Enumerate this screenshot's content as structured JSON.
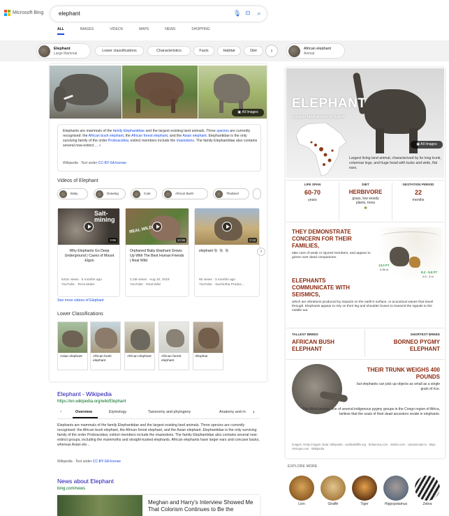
{
  "brand": "Microsoft Bing",
  "search": {
    "query": "elephant"
  },
  "tabs": [
    "ALL",
    "IMAGES",
    "VIDEOS",
    "MAPS",
    "NEWS",
    "SHOPPING"
  ],
  "entity": {
    "name": "Elephant",
    "type": "Large Mammal"
  },
  "filters": [
    "Lower classifications",
    "Characteristics",
    "Facts",
    "Habitat",
    "Diet"
  ],
  "right_chip": {
    "name": "African elephant",
    "type": "Animal"
  },
  "all_images": "All Images",
  "description": {
    "pre": "Elephants are mammals of the ",
    "l1": "family Elephantidae",
    "m1": " and the largest existing land animals. Three ",
    "l2": "species",
    "m2": " are currently recognised: the ",
    "l3": "African bush elephant",
    "m3": ", the ",
    "l4": "African forest elephant",
    "m4": ", and the ",
    "l5": "Asian elephant",
    "m5": ". Elephantidae is the only surviving family of the order ",
    "l6": "Proboscidea",
    "m6": "; extinct members include the ",
    "l7": "mastodons",
    "m7": ". The family Elephantidae also contains several now-extinct ... ",
    "more": "»",
    "source": "Wikipedia · Text under ",
    "license": "CC-BY-SA license"
  },
  "videos": {
    "heading": "Videos of Elephant",
    "chips": [
      "Baby",
      "Drawing",
      "Cute",
      "African Bush",
      "Thailand"
    ],
    "items": [
      {
        "title": "Why Elephants Go Deep Underground | Caves of Mount Elgon",
        "overlay": "Salt-\nmining",
        "duration": "3:06",
        "views": "641K views · 5 months ago",
        "source": "YouTube · Terra Mater"
      },
      {
        "title": "Orphaned Baby Elephant Grows Up With The Best Human Friends | Real Wild",
        "overlay": "REAL WILD",
        "duration": "13:36",
        "views": "2.2M views · Aug 10, 2019",
        "source": "YouTube · Real Wild"
      },
      {
        "title": "elephant 🐘 🐘 🐘",
        "overlay": "",
        "duration": "2:13",
        "views": "50 views · 3 months ago",
        "source": "YouTube · Sachintha Produc..."
      }
    ],
    "see_more": "See more videos of Elephant"
  },
  "lower": {
    "heading": "Lower Classifications",
    "items": [
      "Asian elephant",
      "African bush elephant",
      "African elephant",
      "African forest elephant",
      "Elephas"
    ]
  },
  "wiki": {
    "title": "Elephant - Wikipedia",
    "url": "https://en.wikipedia.org/wiki/Elephant",
    "tabs": [
      "Overview",
      "Etymology",
      "Taxonomy and phylogeny",
      "Anatomy and m"
    ],
    "text": "Elephants are mammals of the family Elephantidae and the largest existing land animals. Three species are currently recognised: the African bush elephant, the African forest elephant, and the Asian elephant. Elephantidae is the only surviving family of the order Proboscidea; extinct members include the mastodons. The family Elephantidae also contains several now-extinct groups, including the mammoths and straight-tusked elephants. African elephants have larger ears and concave backs, whereas Asian ele...",
    "source": "Wikipedia · Text under ",
    "license": "CC-BY-SA license"
  },
  "news": {
    "title": "News about Elephant",
    "url": "bing.com/news",
    "headline": "Meghan and Harry's Interview Showed Me That Colorism Continues to Be the"
  },
  "panel": {
    "title": "ELEPHANT",
    "subtitle": "Largest land animal on Earth",
    "all_images": "All Images",
    "summary": "Largest living land animal, characterized by its long trunk, columnar legs, and huge head with tusks and wide, flat ears.",
    "stats": [
      {
        "label": "LIFE SPAN",
        "value": "60-70",
        "unit": "years"
      },
      {
        "label": "DIET",
        "value": "HERBIVORE",
        "unit": "grass, low woody plants, trees"
      },
      {
        "label": "GESTATION PERIOD",
        "value": "22",
        "unit": "months"
      }
    ],
    "fact1_title": "THEY DEMONSTRATE CONCERN FOR THEIR FAMILIES,",
    "fact1_text": "take care of weak or injured members, and appear to grieve over dead companions.",
    "height1": "13.0 FT",
    "height1m": "3.96 m",
    "height2": "8.2 - 9.8 FT",
    "height2m": "2.5 - 3 m",
    "fact2_title": "ELEPHANTS COMMUNICATE WITH SEISMICS,",
    "fact2_text": "which are vibrations produced by impacts on the earth's surface, or acoustical waves that travel through. Elephants appear to rely on their leg and shoulder bones to transmit the signals to the middle ear.",
    "tallest_label": "TALLEST BREED",
    "tallest": "AFRICAN BUSH ELEPHANT",
    "shortest_label": "SHORTEST BREED",
    "shortest": "BORNEO PYGMY ELEPHANT",
    "trunk_title": "THEIR TRUNK WEIGHS 400 POUNDS",
    "trunk_text": "but elephants can pick up objects as small as a single grain of rice.",
    "mbuti": "The Mbuti people, one of several indigenous pygmy groups in the Congo region of Africa, believe that the souls of their dead ancestors reside in elephants.",
    "credits": "Images: Getty Images. Data: Wikipedia · worldwildlife.org · britannica.com · insider.com · cuteanimals.ru · Map: Vemaps.com · Wikipedia"
  },
  "explore": {
    "heading": "EXPLORE MORE",
    "items": [
      "Lion",
      "Giraffe",
      "Tiger",
      "Hippopotamus",
      "Zebra"
    ]
  }
}
